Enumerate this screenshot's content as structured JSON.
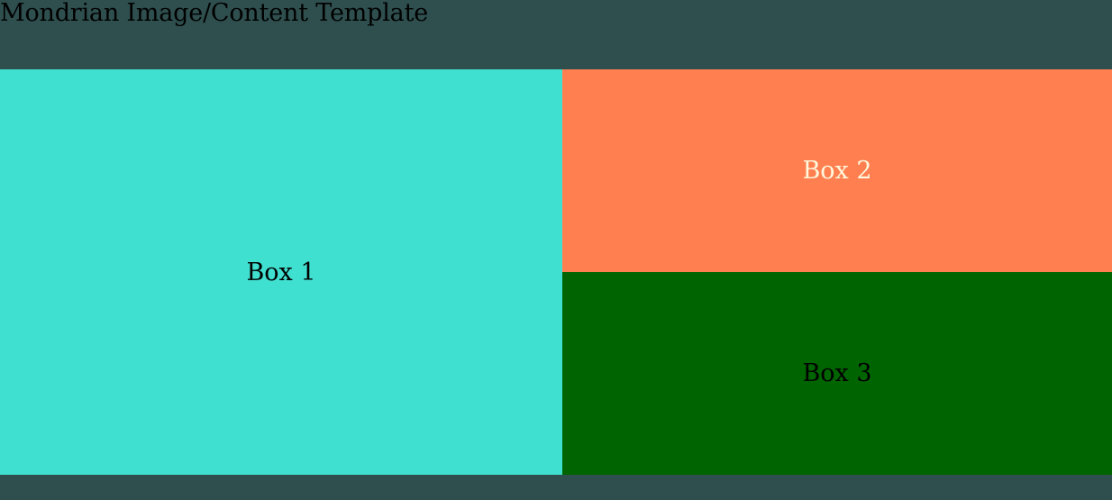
{
  "page": {
    "title": "Mondrian Image/Content Template",
    "background_color": "#2f4f4f"
  },
  "boxes": [
    {
      "label": "Box 1",
      "background_color": "#40e0d0",
      "text_color": "#000000"
    },
    {
      "label": "Box 2",
      "background_color": "#ff7f50",
      "text_color": "#fff8dc"
    },
    {
      "label": "Box 3",
      "background_color": "#006400",
      "text_color": "#000000"
    }
  ]
}
